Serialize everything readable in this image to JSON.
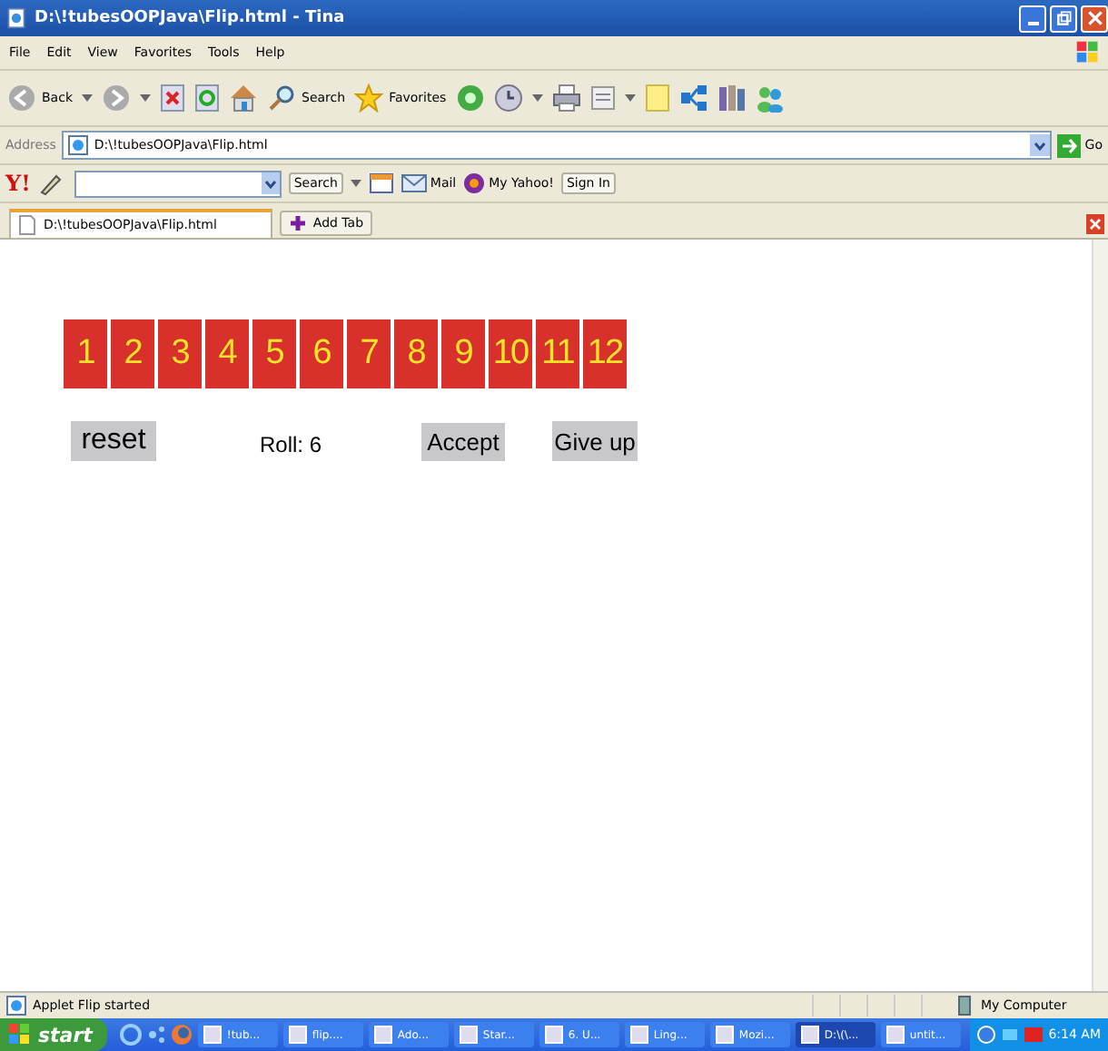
{
  "window": {
    "title": "D:\\!tubesOOPJava\\Flip.html - Tina"
  },
  "menu": [
    "File",
    "Edit",
    "View",
    "Favorites",
    "Tools",
    "Help"
  ],
  "toolbar": {
    "back": "Back",
    "search": "Search",
    "favorites": "Favorites"
  },
  "address": {
    "label": "Address",
    "value": "D:\\!tubesOOPJava\\Flip.html",
    "go": "Go"
  },
  "yahoo_bar": {
    "logo": "Y!",
    "search": "Search",
    "mail": "Mail",
    "my_yahoo": "My Yahoo!",
    "sign_in": "Sign In"
  },
  "tabs": [
    {
      "label": "D:\\!tubesOOPJava\\Flip.html",
      "selected": true
    }
  ],
  "add_tab": "Add Tab",
  "applet": {
    "tiles": [
      "1",
      "2",
      "3",
      "4",
      "5",
      "6",
      "7",
      "8",
      "9",
      "10",
      "11",
      "12"
    ],
    "reset": "reset",
    "roll": "Roll: 6",
    "accept": "Accept",
    "give_up": "Give up"
  },
  "status_bar": {
    "text": "Applet Flip started",
    "zone": "My Computer"
  },
  "taskbar": {
    "start": "start",
    "items": [
      {
        "label": "!tub...",
        "selected": false
      },
      {
        "label": "flip....",
        "selected": false
      },
      {
        "label": "Ado...",
        "selected": false
      },
      {
        "label": "Star...",
        "selected": false
      },
      {
        "label": "6. U...",
        "selected": false
      },
      {
        "label": "Ling...",
        "selected": false
      },
      {
        "label": "Mozi...",
        "selected": false
      },
      {
        "label": "D:\\(\\...",
        "selected": true
      },
      {
        "label": "untit...",
        "selected": false
      }
    ],
    "clock": "6:14 AM"
  }
}
